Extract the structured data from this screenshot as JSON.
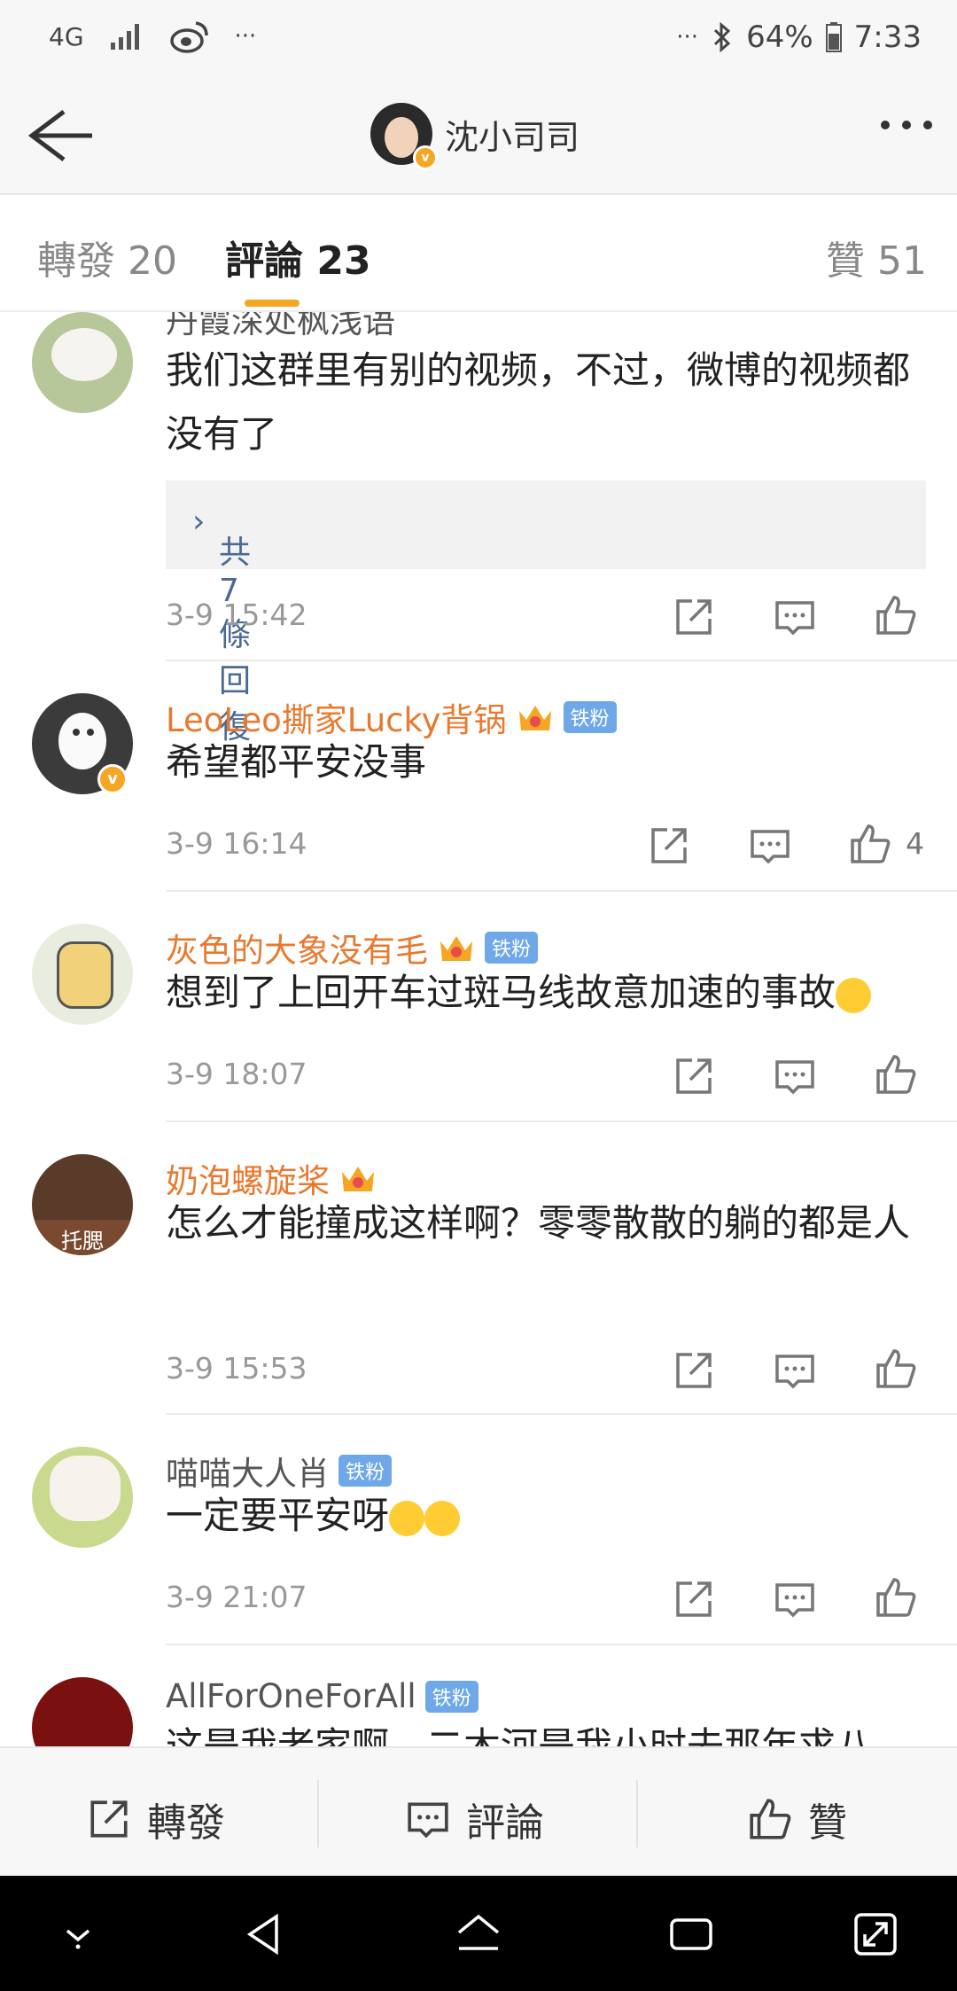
{
  "status_bar": {
    "network": "4G",
    "extra": "···",
    "right_dots": "···",
    "battery": "64%",
    "time": "7:33"
  },
  "header": {
    "title": "沈小司司"
  },
  "tabs": [
    {
      "label": "轉發",
      "count": "20"
    },
    {
      "label": "評論",
      "count": "23"
    },
    {
      "label": "贊",
      "count": "51"
    }
  ],
  "comments": [
    {
      "username": "丹霞深处枫浅语",
      "text": "我们这群里有别的视频，不过，微博的视频都没有了",
      "reply_link": "共7條回復",
      "time": "3-9 15:42",
      "likes": ""
    },
    {
      "username": "LeoLeo撕家Lucky背锅",
      "badge": "铁粉",
      "text": "希望都平安没事",
      "time": "3-9 16:14",
      "likes": "4"
    },
    {
      "username": "灰色的大象没有毛",
      "badge": "铁粉",
      "text": "想到了上回开车过斑马线故意加速的事故",
      "time": "3-9 18:07",
      "likes": ""
    },
    {
      "username": "奶泡螺旋桨",
      "avatar_text": "托腮",
      "text": "怎么才能撞成这样啊？零零散散的躺的都是人",
      "time": "3-9 15:53",
      "likes": ""
    },
    {
      "username": "喵喵大人肖",
      "badge": "铁粉",
      "text": "一定要平安呀",
      "time": "3-9 21:07",
      "likes": ""
    },
    {
      "username": "AllForOneForAll",
      "badge": "铁粉",
      "text": "这是我老家啊，二木河是我小时去那年求八"
    }
  ],
  "bottom_bar": {
    "repost": "轉發",
    "comment": "評論",
    "like": "贊"
  },
  "colors": {
    "accent": "#f5a623",
    "username_gold": "#e8792e",
    "link_blue": "#4a6a96",
    "fan_badge": "#6ea8e8"
  }
}
